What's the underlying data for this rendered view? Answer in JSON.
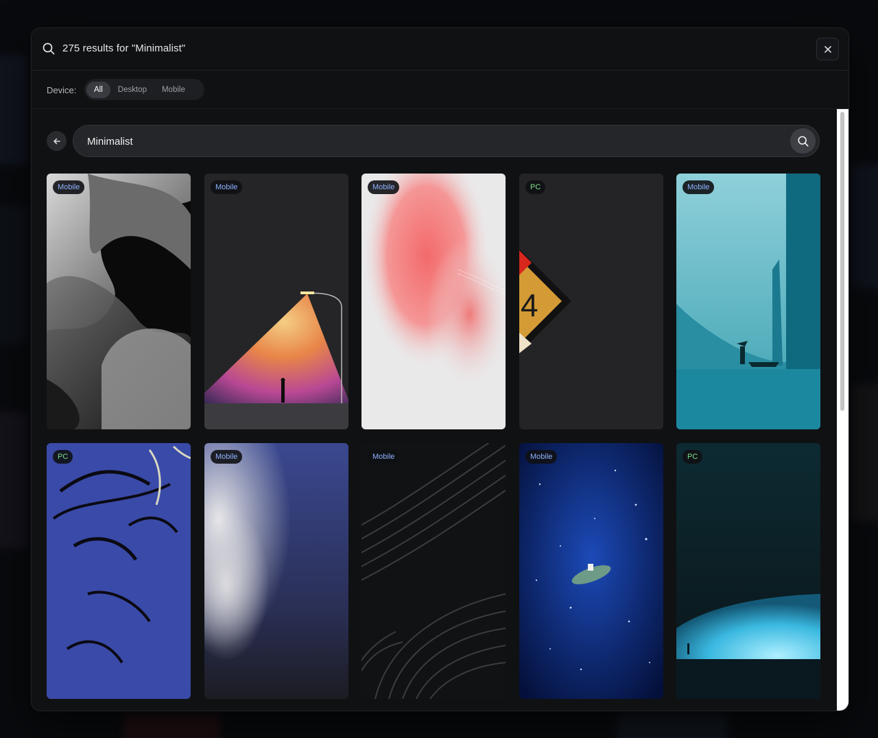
{
  "header": {
    "title": "275 results for \"Minimalist\""
  },
  "filter": {
    "label": "Device:",
    "options": [
      "All",
      "Desktop",
      "Mobile"
    ],
    "selected": "All"
  },
  "search": {
    "value": "Minimalist"
  },
  "results": [
    {
      "badge": "Mobile",
      "art": "gray-waves"
    },
    {
      "badge": "Mobile",
      "art": "streetlight-figure"
    },
    {
      "badge": "Mobile",
      "art": "pink-gradient-wave"
    },
    {
      "badge": "PC",
      "art": "diamond-sign-4"
    },
    {
      "badge": "Mobile",
      "art": "teal-canyon-fisherman"
    },
    {
      "badge": "PC",
      "art": "blue-anime-face"
    },
    {
      "badge": "Mobile",
      "art": "blue-blur"
    },
    {
      "badge": "Mobile",
      "art": "dark-line-pattern"
    },
    {
      "badge": "Mobile",
      "art": "night-sea-boat"
    },
    {
      "badge": "PC",
      "art": "planet-horizon"
    }
  ],
  "colors": {
    "modal_bg": "#101113",
    "badge_mobile": "#8fb3ff",
    "badge_pc": "#7fe08a",
    "active_segment": "#3a3b40"
  },
  "icons": [
    "search-icon",
    "close-icon",
    "arrow-left-icon",
    "search-icon"
  ]
}
